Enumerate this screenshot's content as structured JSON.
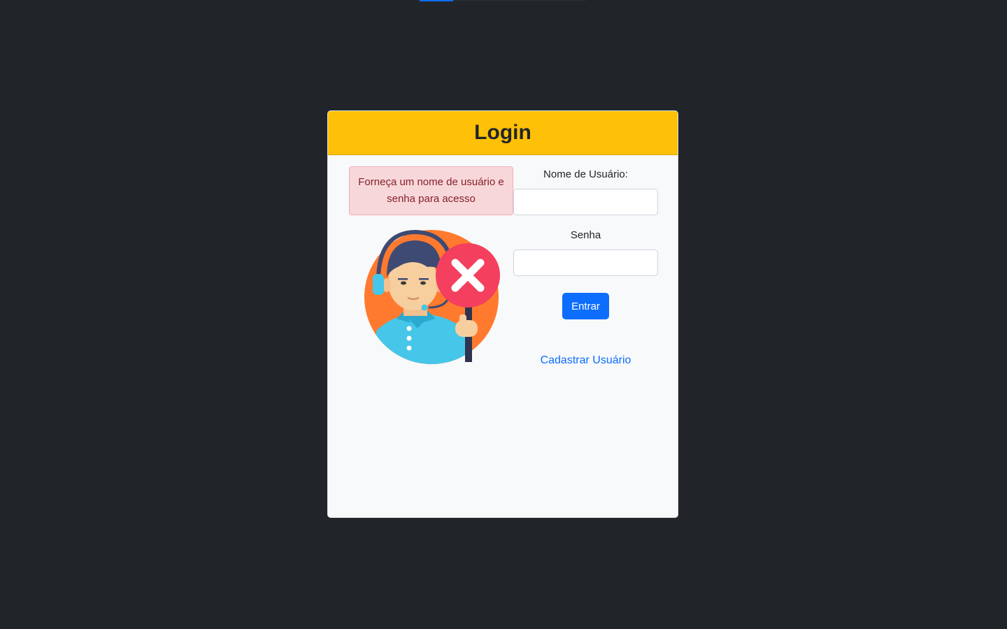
{
  "header": {
    "title": "Login"
  },
  "alert": {
    "message": "Forneça um nome de usuário e senha para acesso"
  },
  "form": {
    "username_label": "Nome de Usuário:",
    "username_value": "",
    "password_label": "Senha",
    "password_value": "",
    "submit_label": "Entrar",
    "register_link": "Cadastrar Usuário"
  },
  "illustration": {
    "icon": "support-agent-access-denied-icon"
  },
  "colors": {
    "page_background": "#212529",
    "card_background": "#f8f9fa",
    "header_background": "#ffc107",
    "alert_background": "#f8d7da",
    "alert_text": "#842029",
    "primary": "#0d6efd",
    "denied_sign": "#f43f5e",
    "illustration_ring": "#ff7a2f"
  }
}
